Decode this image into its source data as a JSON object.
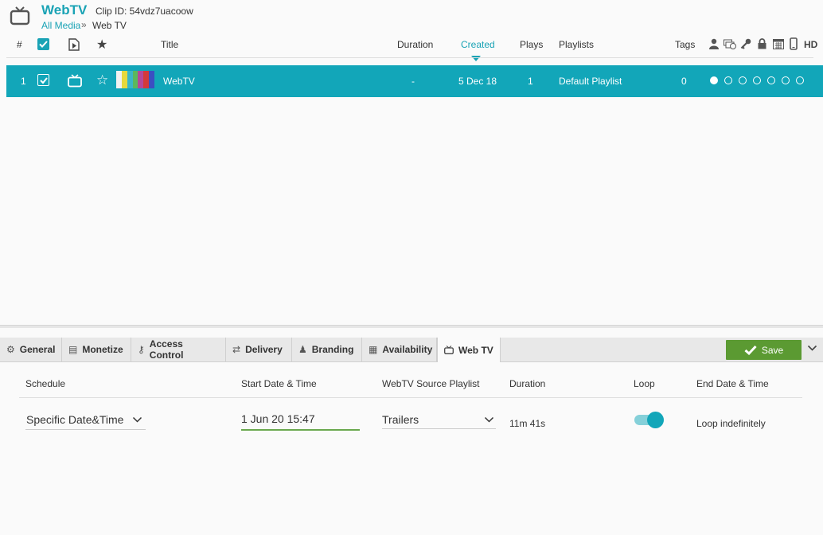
{
  "header": {
    "app_title": "WebTV",
    "clip_id": "Clip ID: 54vdz7uacoow",
    "breadcrumb_link": "All Media",
    "breadcrumb_sep": "»",
    "breadcrumb_current": "Web TV"
  },
  "columns": {
    "num": "#",
    "title": "Title",
    "duration": "Duration",
    "created": "Created",
    "plays": "Plays",
    "playlists": "Playlists",
    "tags": "Tags",
    "hd": "HD"
  },
  "row": {
    "num": "1",
    "title": "WebTV",
    "duration": "-",
    "created": "5 Dec 18",
    "plays": "1",
    "playlist": "Default Playlist",
    "tags": "0",
    "status_dots": [
      true,
      false,
      false,
      false,
      false,
      false,
      false
    ]
  },
  "tabs": [
    {
      "label": "General",
      "icon": "gear-icon"
    },
    {
      "label": "Monetize",
      "icon": "money-icon"
    },
    {
      "label": "Access Control",
      "icon": "key-icon"
    },
    {
      "label": "Delivery",
      "icon": "shuffle-icon"
    },
    {
      "label": "Branding",
      "icon": "stamp-icon"
    },
    {
      "label": "Availability",
      "icon": "calendar-icon"
    },
    {
      "label": "Web TV",
      "icon": "tv-icon"
    }
  ],
  "save_label": "Save",
  "schedule": {
    "headers": {
      "schedule": "Schedule",
      "start": "Start Date & Time",
      "playlist": "WebTV Source Playlist",
      "duration": "Duration",
      "loop": "Loop",
      "end": "End Date & Time"
    },
    "schedule_value": "Specific Date&Time",
    "start_value": "1 Jun 20 15:47",
    "playlist_value": "Trailers",
    "duration_value": "11m 41s",
    "loop_on": true,
    "end_value": "Loop indefinitely"
  },
  "colors": {
    "accent": "#12a6b9",
    "save": "#5b9a32",
    "field_underline": "#6aa84f"
  }
}
